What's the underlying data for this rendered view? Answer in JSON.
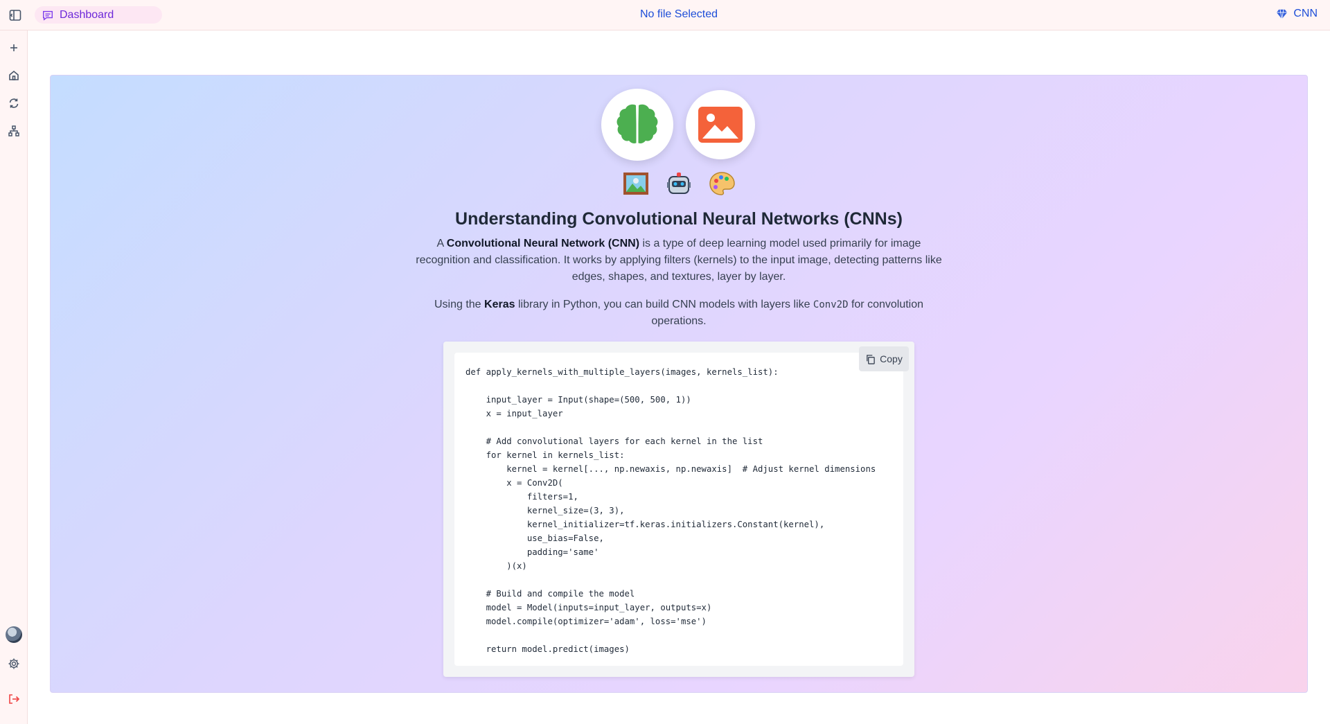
{
  "topbar": {
    "tab_label": "Dashboard",
    "file_title": "No file Selected",
    "brand_label": "CNN"
  },
  "hero": {
    "title": "Understanding Convolutional Neural Networks (CNNs)",
    "para1": {
      "prefix": "A ",
      "bold": "Convolutional Neural Network (CNN)",
      "suffix": " is a type of deep learning model used primarily for image recognition and classification. It works by applying filters (kernels) to the input image, detecting patterns like edges, shapes, and textures, layer by layer."
    },
    "para2": {
      "prefix": "Using the ",
      "bold": "Keras",
      "middle": " library in Python, you can build CNN models with layers like ",
      "code": "Conv2D",
      "suffix": " for convolution operations."
    },
    "icons": [
      "brain-icon",
      "image-icon",
      "framed-picture-emoji",
      "robot-emoji",
      "palette-emoji"
    ]
  },
  "code_block": {
    "copy_label": "Copy",
    "code": "def apply_kernels_with_multiple_layers(images, kernels_list):\n\n    input_layer = Input(shape=(500, 500, 1))\n    x = input_layer\n\n    # Add convolutional layers for each kernel in the list\n    for kernel in kernels_list:\n        kernel = kernel[..., np.newaxis, np.newaxis]  # Adjust kernel dimensions\n        x = Conv2D(\n            filters=1,\n            kernel_size=(3, 3),\n            kernel_initializer=tf.keras.initializers.Constant(kernel),\n            use_bias=False,\n            padding='same'\n        )(x)\n\n    # Build and compile the model\n    model = Model(inputs=input_layer, outputs=x)\n    model.compile(optimizer='adam', loss='mse')\n\n    return model.predict(images)"
  },
  "colors": {
    "accent": "#1d4ed8",
    "tab_text": "#6d28d9",
    "brain_green": "#4caf50",
    "image_orange": "#f4623a"
  }
}
